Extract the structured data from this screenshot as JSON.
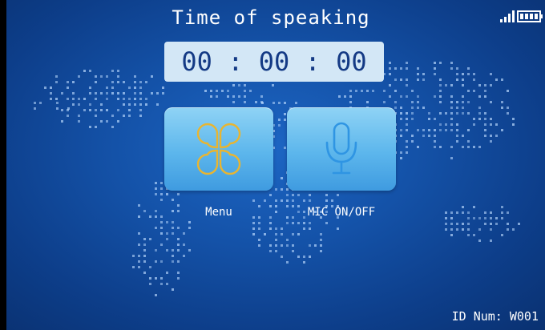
{
  "header": {
    "title": "Time of speaking",
    "signal_icon": "signal-bars-icon",
    "battery_icon": "battery-icon"
  },
  "timer": {
    "value": "00 : 00 : 00"
  },
  "buttons": {
    "menu": {
      "label": "Menu",
      "icon": "four-leaf-clover-icon"
    },
    "mic": {
      "label": "MIC ON/OFF",
      "icon": "microphone-icon"
    }
  },
  "footer": {
    "id_text": "ID Num: W001"
  },
  "colors": {
    "background": "#1452a8",
    "timer_bg": "#d3e7f6",
    "timer_text": "#143a85",
    "tile": "#5cb6ec",
    "menu_icon": "#e9b530",
    "mic_icon": "#2f95e3"
  }
}
